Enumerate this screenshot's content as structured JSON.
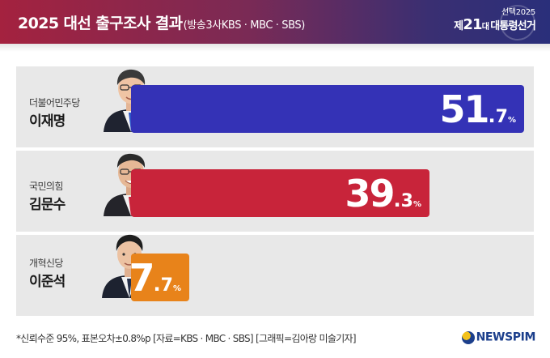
{
  "header": {
    "title": "2025 대선 출구조사 결과",
    "subtitle": "(방송3사KBS · MBC · SBS)",
    "brand_line1": "선택2025",
    "brand_pre": "제",
    "brand_num": "21",
    "brand_mid": "대",
    "brand_post": "대통령선거"
  },
  "colors": {
    "header_start": "#a4223f",
    "header_end": "#2a2f7a",
    "democratic": "#3432b6",
    "ppp": "#c8243a",
    "reform": "#e8831a",
    "row_background": "#e8e8e8"
  },
  "chart_data": {
    "type": "bar",
    "orientation": "horizontal",
    "title": "2025 대선 출구조사 결과",
    "unit": "%",
    "categories": [
      "이재명",
      "김문수",
      "이준석"
    ],
    "values": [
      51.7,
      39.3,
      7.7
    ],
    "rows": [
      {
        "party": "더불어민주당",
        "candidate": "이재명",
        "value": 51.7,
        "int": "51",
        "dec": "7",
        "color": "#3432b6",
        "icon": "candidate-portrait-icon"
      },
      {
        "party": "국민의힘",
        "candidate": "김문수",
        "value": 39.3,
        "int": "39",
        "dec": "3",
        "color": "#c8243a",
        "icon": "candidate-portrait-icon"
      },
      {
        "party": "개혁신당",
        "candidate": "이준석",
        "value": 7.7,
        "int": "7",
        "dec": "7",
        "color": "#e8831a",
        "icon": "candidate-portrait-icon"
      }
    ]
  },
  "footer": {
    "note": "*신뢰수준 95%, 표본오차±0.8%p [자료=KBS · MBC · SBS] [그래픽=김아랑 미술기자]",
    "logo_text": "NEWSPIM"
  }
}
